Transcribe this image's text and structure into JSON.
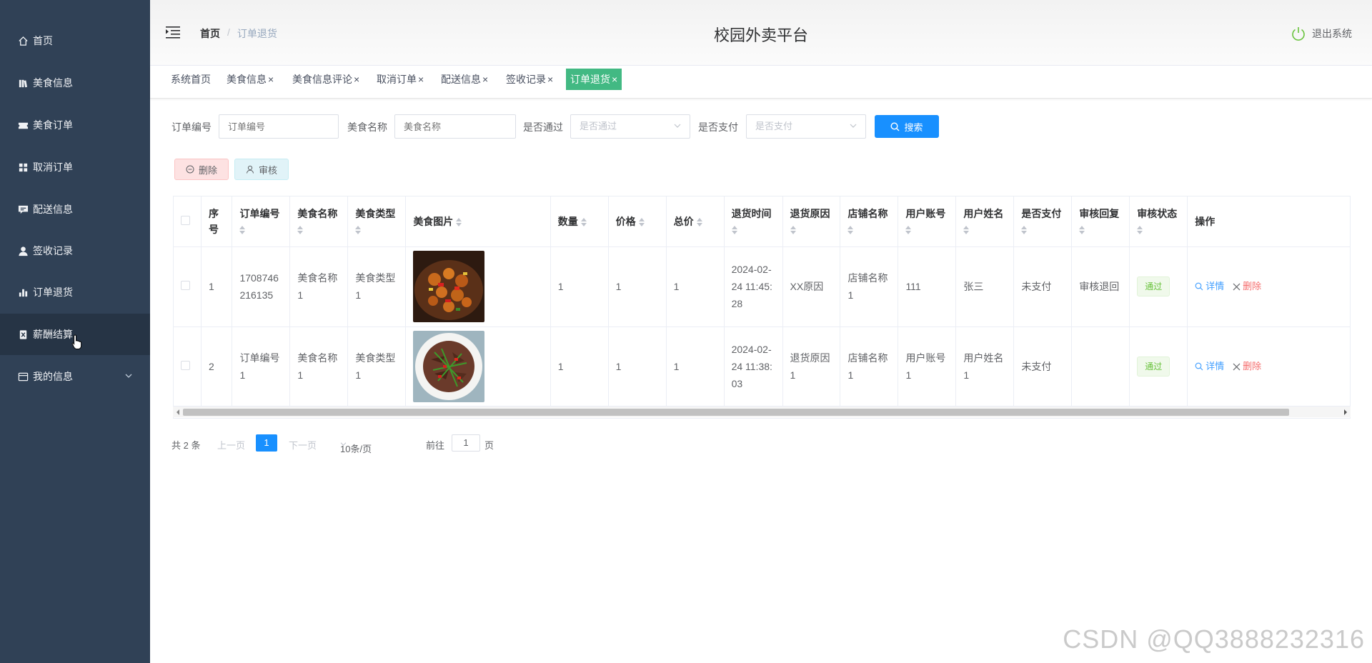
{
  "sidebar": {
    "items": [
      {
        "label": "首页",
        "icon": "home-icon"
      },
      {
        "label": "美食信息",
        "icon": "library-icon"
      },
      {
        "label": "美食订单",
        "icon": "ticket-icon"
      },
      {
        "label": "取消订单",
        "icon": "grid-icon"
      },
      {
        "label": "配送信息",
        "icon": "chat-icon"
      },
      {
        "label": "签收记录",
        "icon": "user-icon"
      },
      {
        "label": "订单退货",
        "icon": "bar-chart-icon"
      },
      {
        "label": "薪酬结算",
        "icon": "document-icon"
      },
      {
        "label": "我的信息",
        "icon": "card-icon"
      }
    ]
  },
  "header": {
    "breadcrumb_home": "首页",
    "breadcrumb_sep": "/",
    "breadcrumb_current": "订单退货",
    "title": "校园外卖平台",
    "logout": "退出系统"
  },
  "tags": [
    {
      "label": "系统首页",
      "closable": false
    },
    {
      "label": "美食信息",
      "closable": true
    },
    {
      "label": "美食信息评论",
      "closable": true
    },
    {
      "label": "取消订单",
      "closable": true
    },
    {
      "label": "配送信息",
      "closable": true
    },
    {
      "label": "签收记录",
      "closable": true
    },
    {
      "label": "订单退货",
      "closable": true,
      "active": true
    }
  ],
  "tag_close": "×",
  "search": {
    "order_no_label": "订单编号",
    "order_no_placeholder": "订单编号",
    "food_name_label": "美食名称",
    "food_name_placeholder": "美食名称",
    "passed_label": "是否通过",
    "passed_placeholder": "是否通过",
    "paid_label": "是否支付",
    "paid_placeholder": "是否支付",
    "button": "搜索"
  },
  "actions": {
    "delete": "删除",
    "audit": "审核"
  },
  "table": {
    "headers": [
      "序号",
      "订单编号",
      "美食名称",
      "美食类型",
      "美食图片",
      "数量",
      "价格",
      "总价",
      "退货时间",
      "退货原因",
      "店铺名称",
      "用户账号",
      "用户姓名",
      "是否支付",
      "审核回复",
      "审核状态",
      "操作"
    ],
    "rows": [
      {
        "index": "1",
        "order_no": "1708746216135",
        "food_name": "美食名称1",
        "food_type": "美食类型1",
        "quantity": "1",
        "price": "1",
        "total": "1",
        "return_time": "2024-02-24 11:45:28",
        "reason": "XX原因",
        "shop": "店铺名称1",
        "account": "111",
        "username": "张三",
        "paid": "未支付",
        "reply": "审核退回",
        "status": "通过"
      },
      {
        "index": "2",
        "order_no": "订单编号1",
        "food_name": "美食名称1",
        "food_type": "美食类型1",
        "quantity": "1",
        "price": "1",
        "total": "1",
        "return_time": "2024-02-24 11:38:03",
        "reason": "退货原因1",
        "shop": "店铺名称1",
        "account": "用户账号1",
        "username": "用户姓名1",
        "paid": "未支付",
        "reply": "",
        "status": "通过"
      }
    ],
    "op_detail": "详情",
    "op_delete": "删除"
  },
  "pager": {
    "total": "共 2 条",
    "prev": "上一页",
    "current": "1",
    "next": "下一页",
    "size": "10条/页",
    "goto": "前往",
    "goto_value": "1",
    "page_unit": "页"
  },
  "watermark": "CSDN @QQ3888232316",
  "colors": {
    "sidebar_bg": "#304156",
    "primary": "#1890ff",
    "active_tag": "#42b983",
    "success": "#67c23a"
  }
}
